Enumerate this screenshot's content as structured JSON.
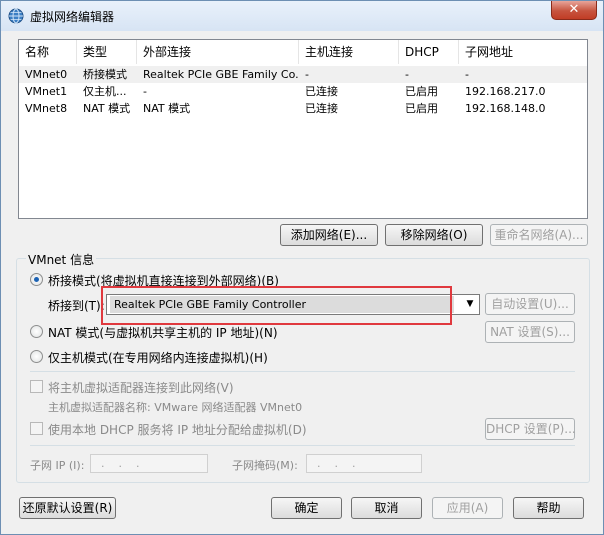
{
  "window": {
    "title": "虚拟网络编辑器",
    "close_label": "✕"
  },
  "network_table": {
    "columns": [
      "名称",
      "类型",
      "外部连接",
      "主机连接",
      "DHCP",
      "子网地址"
    ],
    "rows": [
      [
        "VMnet0",
        "桥接模式",
        "Realtek PCIe GBE Family Co...",
        "-",
        "-",
        "-"
      ],
      [
        "VMnet1",
        "仅主机...",
        "-",
        "已连接",
        "已启用",
        "192.168.217.0"
      ],
      [
        "VMnet8",
        "NAT 模式",
        "NAT 模式",
        "已连接",
        "已启用",
        "192.168.148.0"
      ]
    ]
  },
  "table_buttons": {
    "add": "添加网络(E)...",
    "remove": "移除网络(O)",
    "rename": "重命名网络(A)..."
  },
  "vmnet_info": {
    "title": "VMnet 信息",
    "bridged_label": "桥接模式(将虚拟机直接连接到外部网络)(B)",
    "bridge_to_label": "桥接到(T):",
    "bridge_to_value": "Realtek PCIe GBE Family Controller",
    "auto_settings": "自动设置(U)...",
    "nat_label": "NAT 模式(与虚拟机共享主机的 IP 地址)(N)",
    "nat_settings": "NAT 设置(S)...",
    "hostonly_label": "仅主机模式(在专用网络内连接虚拟机)(H)",
    "connect_adapter_label": "将主机虚拟适配器连接到此网络(V)",
    "adapter_name_label": "主机虚拟适配器名称: VMware 网络适配器 VMnet0",
    "dhcp_label": "使用本地 DHCP 服务将 IP 地址分配给虚拟机(D)",
    "dhcp_settings": "DHCP 设置(P)...",
    "subnet_ip_label": "子网 IP (I):",
    "subnet_ip_value": "...",
    "subnet_mask_label": "子网掩码(M):",
    "subnet_mask_value": "..."
  },
  "bottom_buttons": {
    "restore": "还原默认设置(R)",
    "ok": "确定",
    "cancel": "取消",
    "apply": "应用(A)",
    "help": "帮助"
  },
  "colors": {
    "highlight": "#e0393e",
    "accent": "#1c62b3"
  }
}
